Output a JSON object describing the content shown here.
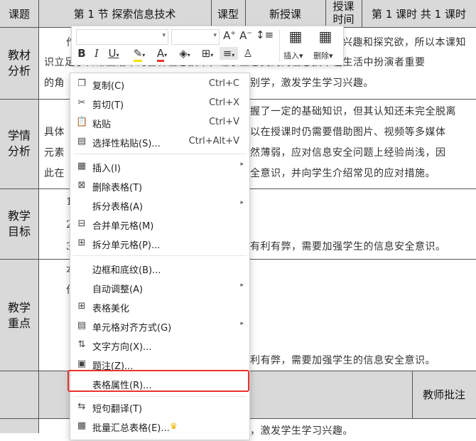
{
  "table": {
    "header": {
      "c1": "课题",
      "c2": "第 1 节  探索信息技术",
      "c3": "课型",
      "c4": "新授课",
      "c5_line1": "授课",
      "c5_line2": "时间",
      "c6": "第 1 课时  共 1 课时"
    },
    "rows": [
      {
        "label_1": "教材",
        "label_2": "分析",
        "lines": [
          "作",
          "识立足于日常生活中的各种信息技术，让学生感受到到信息技术在生活中扮演者重要",
          "的角"
        ],
        "right_1": "兴趣和探究欲，所以本课知",
        "right_3": "别学，激发学生学习兴趣。"
      },
      {
        "label_1": "学情",
        "label_2": "分析",
        "lines": [
          "具体",
          "元素",
          "此在"
        ],
        "right_1": "握了一定的基础知识，但其认知还未完全脱离",
        "right_2": "以在授课时仍需要借助图片、视频等多媒体",
        "right_3": "然薄弱，应对信息安全问题上经验尚浅，因",
        "right_4": "全意识，并向学生介绍常见的应对措施。"
      },
      {
        "label_1": "教学",
        "label_2": "目标",
        "lines": [
          "1",
          "2",
          "3"
        ],
        "right_1": "有利有弊，需要加强学生的信息安全意识。"
      },
      {
        "label_1": "教学",
        "label_2": "重点",
        "lines": [
          "本",
          "作"
        ],
        "right_1": "利有弊，需要加强学生的信息安全意识。"
      }
    ],
    "bottom_header": "教师批注",
    "bottom_text": "，激发学生学习兴趣。"
  },
  "toolbar": {
    "font_name": "",
    "font_size": "",
    "bold": "B",
    "italic": "I",
    "underline": "U",
    "insert_label": "插入",
    "delete_label": "删除"
  },
  "menu": {
    "items": [
      {
        "label": "复制(C)",
        "shortcut": "Ctrl+C",
        "icon": "copy-icon"
      },
      {
        "label": "剪切(T)",
        "shortcut": "Ctrl+X",
        "icon": "cut-icon"
      },
      {
        "label": "粘贴",
        "shortcut": "Ctrl+V",
        "icon": "paste-icon"
      },
      {
        "label": "选择性粘贴(S)...",
        "shortcut": "Ctrl+Alt+V",
        "icon": "paste-special-icon"
      },
      {
        "label": "插入(I)",
        "icon": "insert-table-icon",
        "submenu": true
      },
      {
        "label": "删除表格(T)",
        "icon": "delete-table-icon"
      },
      {
        "label": "拆分表格(A)",
        "icon": "",
        "submenu": true
      },
      {
        "label": "合并单元格(M)",
        "icon": "merge-cells-icon"
      },
      {
        "label": "拆分单元格(P)...",
        "icon": "split-cells-icon"
      },
      {
        "label": "边框和底纹(B)...",
        "icon": ""
      },
      {
        "label": "自动调整(A)",
        "icon": "",
        "submenu": true
      },
      {
        "label": "表格美化",
        "icon": "table-style-icon"
      },
      {
        "label": "单元格对齐方式(G)",
        "icon": "cell-align-icon",
        "submenu": true
      },
      {
        "label": "文字方向(X)...",
        "icon": "text-direction-icon"
      },
      {
        "label": "题注(Z)...",
        "icon": "caption-icon"
      },
      {
        "label": "表格属性(R)...",
        "icon": "",
        "highlighted": true
      },
      {
        "label": "短句翻译(T)",
        "icon": "translate-icon"
      },
      {
        "label": "批量汇总表格(E)...",
        "icon": "batch-summary-icon",
        "premium": true
      }
    ]
  },
  "colors": {
    "highlight_border": "#e8322e",
    "header_fill": "#d9d9d9",
    "crown": "#f0b400"
  }
}
